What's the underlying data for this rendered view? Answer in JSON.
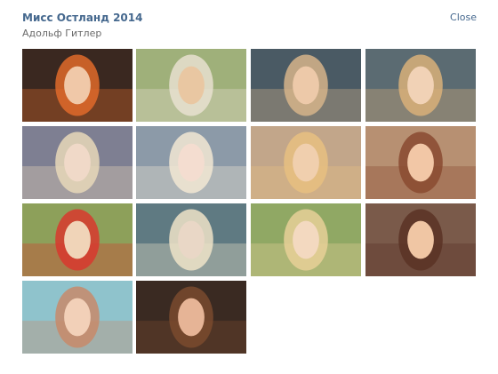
{
  "album": {
    "title": "Мисс Остланд 2014",
    "author": "Адольф Гитлер",
    "close_label": "Close"
  },
  "photos": [
    {
      "id": "p1",
      "bg": "#3a2820",
      "accent": "#e06a2a",
      "skin": "#f0c8a8"
    },
    {
      "id": "p2",
      "bg": "#9fb07a",
      "accent": "#e8e0d0",
      "skin": "#e9c7a2"
    },
    {
      "id": "p3",
      "bg": "#4a5a64",
      "accent": "#d6b48a",
      "skin": "#edc9a9"
    },
    {
      "id": "p4",
      "bg": "#5b6b72",
      "accent": "#d9b079",
      "skin": "#f1d2b6"
    },
    {
      "id": "p5",
      "bg": "#7e7f92",
      "accent": "#e8d8b8",
      "skin": "#f0d9c8"
    },
    {
      "id": "p6",
      "bg": "#8c9aa8",
      "accent": "#f2e8d4",
      "skin": "#f4ddd0"
    },
    {
      "id": "p7",
      "bg": "#c2a68a",
      "accent": "#e7c080",
      "skin": "#f0cfae"
    },
    {
      "id": "p8",
      "bg": "#b79072",
      "accent": "#8a4a30",
      "skin": "#f2c7a6"
    },
    {
      "id": "p9",
      "bg": "#8da05a",
      "accent": "#d8382e",
      "skin": "#f0d4b8"
    },
    {
      "id": "p10",
      "bg": "#5f7a82",
      "accent": "#efe3c8",
      "skin": "#e9d7c6"
    },
    {
      "id": "p11",
      "bg": "#90a864",
      "accent": "#e8d098",
      "skin": "#f3d9c0"
    },
    {
      "id": "p12",
      "bg": "#7a5a4a",
      "accent": "#5a3224",
      "skin": "#f0c6a4"
    },
    {
      "id": "p13",
      "bg": "#8fc3cc",
      "accent": "#c88a6a",
      "skin": "#f2d0b8"
    },
    {
      "id": "p14",
      "bg": "#3a2a22",
      "accent": "#7a4a2e",
      "skin": "#e6b496"
    }
  ]
}
